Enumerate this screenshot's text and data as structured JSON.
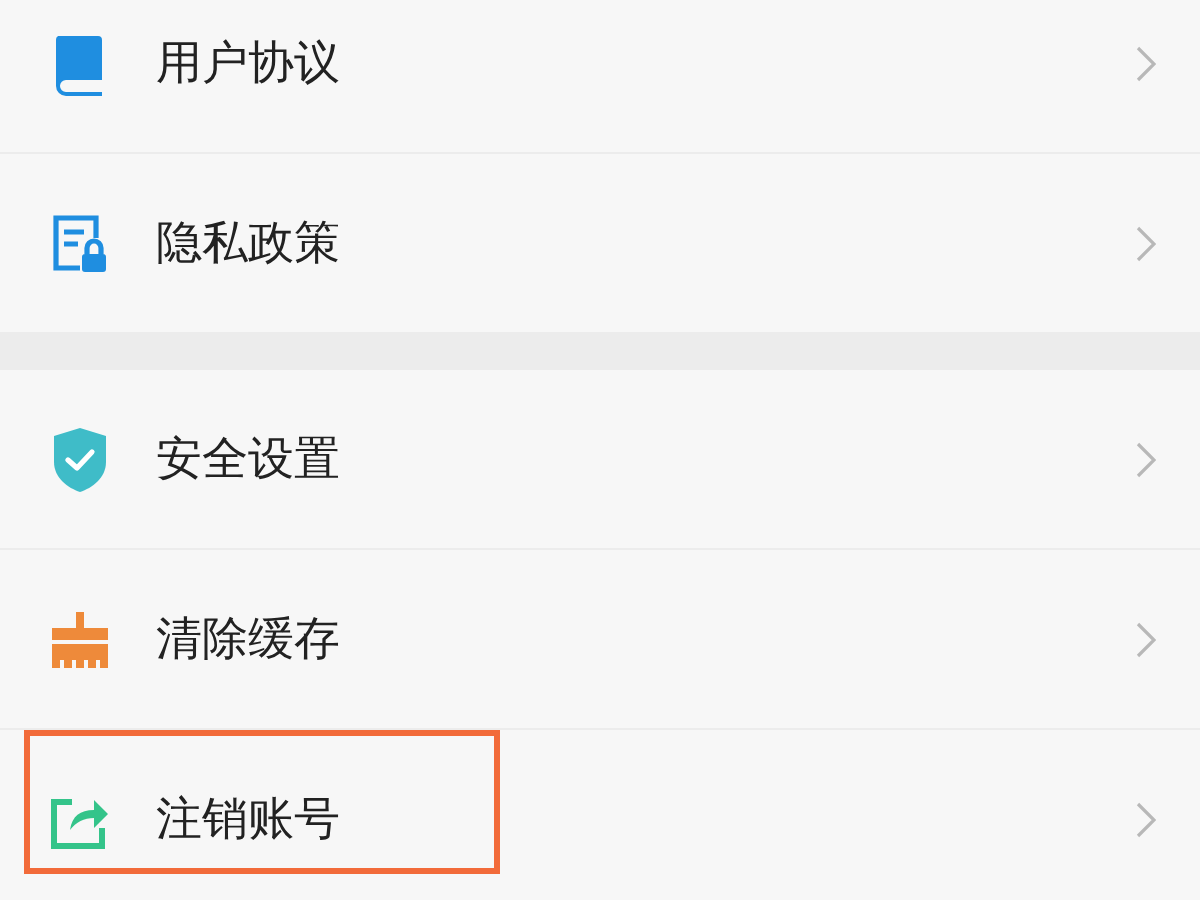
{
  "groups": [
    {
      "items": [
        {
          "kind": "book",
          "label": "用户协议",
          "highlighted": false
        },
        {
          "kind": "privacy",
          "label": "隐私政策",
          "highlighted": false
        }
      ]
    },
    {
      "items": [
        {
          "kind": "security",
          "label": "安全设置",
          "highlighted": false
        },
        {
          "kind": "clean",
          "label": "清除缓存",
          "highlighted": false
        },
        {
          "kind": "export",
          "label": "注销账号",
          "highlighted": true
        }
      ]
    }
  ]
}
